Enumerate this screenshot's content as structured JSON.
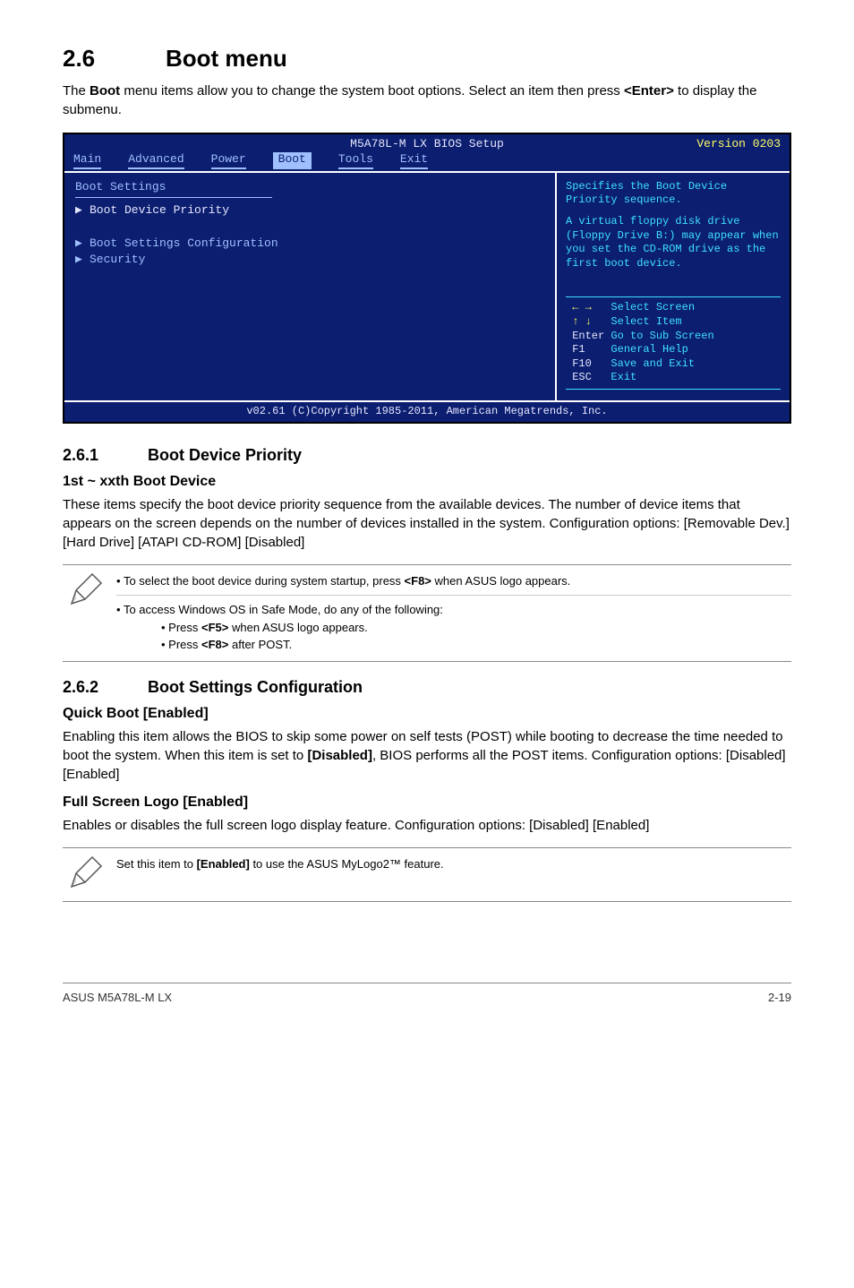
{
  "chapter": {
    "num": "2.6",
    "title": "Boot menu"
  },
  "intro": {
    "pre": "The ",
    "bold1": "Boot",
    "mid": " menu items allow you to change the system boot options. Select an item then press ",
    "bold2": "<Enter>",
    "post": " to display the submenu."
  },
  "bios": {
    "title": "M5A78L-M LX BIOS Setup",
    "version": "Version 0203",
    "menu": {
      "main": "Main",
      "advanced": "Advanced",
      "power": "Power",
      "boot": "Boot",
      "tools": "Tools",
      "exit": "Exit"
    },
    "left": {
      "heading": "Boot Settings",
      "item1": "Boot Device Priority",
      "item2": "Boot Settings Configuration",
      "item3": "Security"
    },
    "right": {
      "help1": "Specifies the Boot Device Priority sequence.",
      "help2": "A virtual floppy disk drive (Floppy Drive B:) may appear when you set the CD-ROM drive as the first boot device.",
      "nav": {
        "l1a": "  ",
        "l1b": "Select Screen",
        "l2a": "  ",
        "l2b": "Select Item",
        "l3a": "Enter",
        "l3b": "Go to Sub Screen",
        "l4a": "F1",
        "l4b": "General Help",
        "l5a": "F10",
        "l5b": "Save and Exit",
        "l6a": "ESC",
        "l6b": "Exit"
      }
    },
    "footer": "v02.61 (C)Copyright 1985-2011, American Megatrends, Inc."
  },
  "s261": {
    "num": "2.6.1",
    "title": "Boot Device Priority",
    "topic": "1st ~ xxth Boot Device",
    "para": "These items specify the boot device priority sequence from the available devices. The number of device items that appears on the screen depends on the number of devices installed in the system. Configuration options: [Removable Dev.] [Hard Drive] [ATAPI CD-ROM] [Disabled]"
  },
  "note1": {
    "b1_pre": "To select the boot device during system startup, press ",
    "b1_bold": "<F8>",
    "b1_post": " when ASUS logo appears.",
    "b2": "To access Windows OS in Safe Mode, do any of the following:",
    "s1_pre": "Press ",
    "s1_bold": "<F5>",
    "s1_post": " when ASUS logo appears.",
    "s2_pre": "Press ",
    "s2_bold": "<F8>",
    "s2_post": " after POST."
  },
  "s262": {
    "num": "2.6.2",
    "title": "Boot Settings Configuration",
    "t1": "Quick Boot [Enabled]",
    "p1_pre": "Enabling this item allows the BIOS to skip some power on self tests (POST) while booting to decrease the time needed to boot the system. When this item is set to ",
    "p1_bold": "[Disabled]",
    "p1_post": ", BIOS performs all the POST items. Configuration options: [Disabled] [Enabled]",
    "t2": "Full Screen Logo [Enabled]",
    "p2": "Enables or disables the full screen logo display feature. Configuration options: [Disabled] [Enabled]"
  },
  "note2": {
    "pre": "Set this item to ",
    "bold": "[Enabled]",
    "post": " to use the ASUS MyLogo2™ feature."
  },
  "footer": {
    "left": "ASUS M5A78L-M LX",
    "right": "2-19"
  }
}
